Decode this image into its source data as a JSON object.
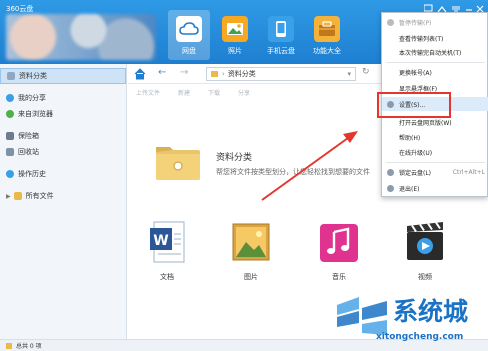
{
  "app": {
    "title": "360云盘"
  },
  "nav": [
    {
      "label": "网盘",
      "icon": "cloud-drive-icon"
    },
    {
      "label": "照片",
      "icon": "photo-icon"
    },
    {
      "label": "手机云盘",
      "icon": "phone-cloud-icon"
    },
    {
      "label": "功能大全",
      "icon": "features-icon"
    }
  ],
  "sidebar": {
    "items": [
      {
        "label": "资料分类",
        "icon": "category-icon"
      },
      {
        "label": "我的分享",
        "icon": "share-icon"
      },
      {
        "label": "来自浏览器",
        "icon": "browser-icon"
      },
      {
        "label": "保险箱",
        "icon": "safe-icon"
      },
      {
        "label": "回收站",
        "icon": "recycle-bin-icon"
      },
      {
        "label": "操作历史",
        "icon": "history-icon"
      },
      {
        "label": "所有文件",
        "icon": "folder-icon"
      }
    ]
  },
  "path": {
    "current": "资料分类"
  },
  "toolbar": {
    "upload": "上传文件",
    "new": "新建",
    "download": "下载",
    "share": "分享"
  },
  "banner": {
    "title": "资料分类",
    "desc": "帮您将文件按类型划分，让您轻松找到想要的文件"
  },
  "tiles": [
    {
      "label": "文档",
      "icon": "document-icon"
    },
    {
      "label": "图片",
      "icon": "image-icon"
    },
    {
      "label": "音乐",
      "icon": "music-icon"
    },
    {
      "label": "视频",
      "icon": "video-icon"
    }
  ],
  "status": {
    "text": "总共 0 项"
  },
  "menu": {
    "items": [
      {
        "label": "暂停传输(P)",
        "disabled": true
      },
      {
        "label": "查看传输列表(T)"
      },
      {
        "label": "本次传输完自动关机(T)"
      },
      {
        "label": "更换帐号(A)"
      },
      {
        "label": "显示悬浮框(F)"
      },
      {
        "label": "设置(S)..."
      },
      {
        "label": "打开云盘网页版(W)"
      },
      {
        "label": "帮助(H)"
      },
      {
        "label": "在线升级(U)"
      },
      {
        "label": "锁定云盘(L)",
        "shortcut": "Ctrl+Alt+L"
      },
      {
        "label": "退出(E)"
      }
    ]
  },
  "watermark": {
    "text": "系统城",
    "url": "xitongcheng.com"
  },
  "colors": {
    "brand": "#1e7fd0",
    "highlight": "#e3362e",
    "arrow": "#e3362e"
  }
}
